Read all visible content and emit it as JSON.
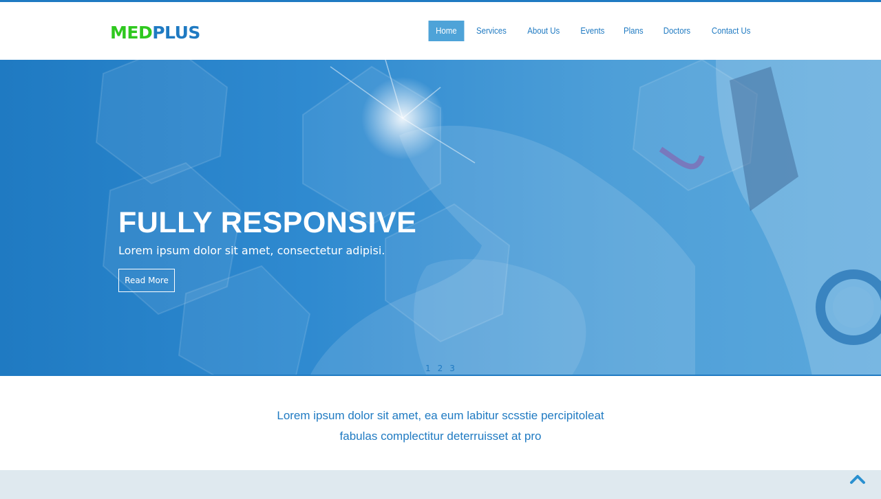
{
  "brand": {
    "part1": "MED",
    "part2": "PLUS"
  },
  "nav": {
    "items": [
      {
        "label": "Home",
        "active": true
      },
      {
        "label": "Services"
      },
      {
        "label": "About Us"
      },
      {
        "label": "Events"
      },
      {
        "label": "Plans"
      },
      {
        "label": "Doctors"
      },
      {
        "label": "Contact Us"
      }
    ]
  },
  "hero": {
    "title": "FULLY RESPONSIVE",
    "subtitle": "Lorem ipsum dolor sit amet, consectetur adipisi.",
    "button": "Read More",
    "pager": [
      "1",
      "2",
      "3"
    ]
  },
  "intro": {
    "line1": "Lorem ipsum dolor sit amet, ea eum labitur scsstie percipitoleat",
    "line2": "fabulas complectitur deterruisset at pro"
  },
  "icons": {
    "back_to_top": "chevron-up-icon"
  },
  "colors": {
    "brand_blue": "#1f7ac2",
    "brand_green": "#2fc81f",
    "nav_active": "#4ea3d8",
    "footer_bg": "#dfe9ef"
  }
}
